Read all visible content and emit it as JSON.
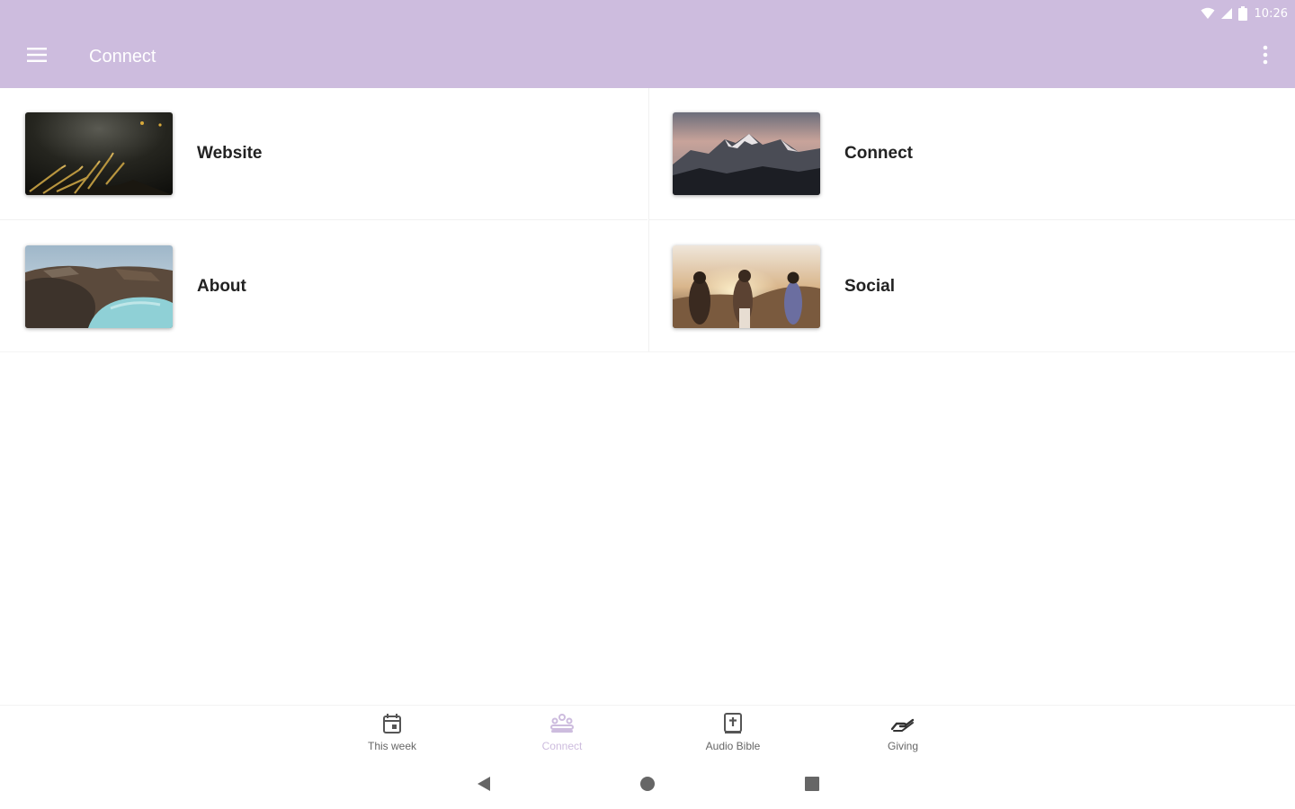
{
  "status_bar": {
    "time": "10:26"
  },
  "app_bar": {
    "title": "Connect",
    "background": "#cdbcde"
  },
  "tiles": [
    {
      "label": "Website",
      "image": "dark-grass-photo"
    },
    {
      "label": "Connect",
      "image": "mountain-sunset-photo"
    },
    {
      "label": "About",
      "image": "crater-lake-photo"
    },
    {
      "label": "Social",
      "image": "friends-sunset-photo"
    }
  ],
  "bottom_nav": [
    {
      "label": "This week",
      "icon": "calendar-icon",
      "active": false
    },
    {
      "label": "Connect",
      "icon": "group-icon",
      "active": true
    },
    {
      "label": "Audio Bible",
      "icon": "bible-icon",
      "active": false
    },
    {
      "label": "Giving",
      "icon": "giving-hand-icon",
      "active": false
    }
  ],
  "colors": {
    "accent": "#cdbcde",
    "text": "#222222",
    "nav_text": "#666666"
  }
}
